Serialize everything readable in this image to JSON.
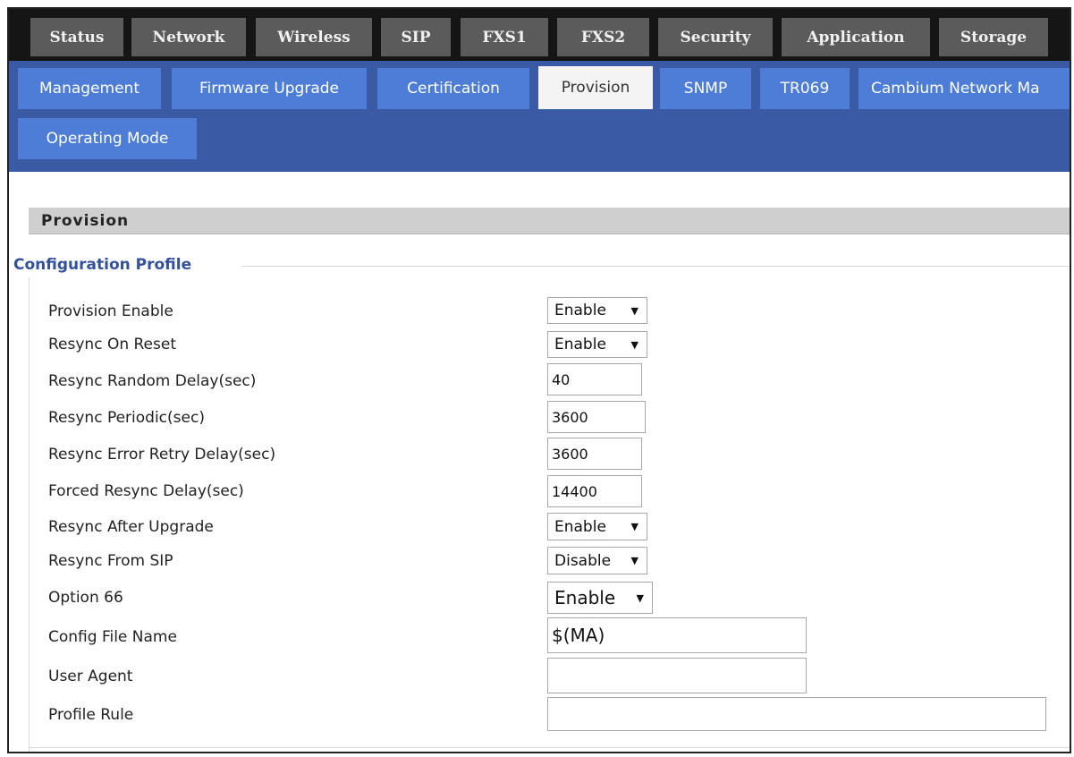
{
  "top_tabs": [
    "Status",
    "Network",
    "Wireless",
    "SIP",
    "FXS1",
    "FXS2",
    "Security",
    "Application",
    "Storage"
  ],
  "sub_tabs": [
    "Management",
    "Firmware Upgrade",
    "Certification",
    "Provision",
    "SNMP",
    "TR069",
    "Cambium Network Ma",
    "Operating Mode"
  ],
  "active_sub_tab": "Provision",
  "section_title": "Provision",
  "fieldset_legend": "Configuration Profile",
  "fields": {
    "provision_enable": {
      "label": "Provision Enable",
      "value": "Enable"
    },
    "resync_on_reset": {
      "label": "Resync On Reset",
      "value": "Enable"
    },
    "resync_random_delay": {
      "label": "Resync Random Delay(sec)",
      "value": "40"
    },
    "resync_periodic": {
      "label": "Resync Periodic(sec)",
      "value": "3600"
    },
    "resync_error_retry_delay": {
      "label": "Resync Error Retry Delay(sec)",
      "value": "3600"
    },
    "forced_resync_delay": {
      "label": "Forced Resync Delay(sec)",
      "value": "14400"
    },
    "resync_after_upgrade": {
      "label": "Resync After Upgrade",
      "value": "Enable"
    },
    "resync_from_sip": {
      "label": "Resync From SIP",
      "value": "Disable"
    },
    "option_66": {
      "label": "Option 66",
      "value": "Enable"
    },
    "config_file_name": {
      "label": "Config File Name",
      "value": "$(MA)"
    },
    "user_agent": {
      "label": "User Agent",
      "value": ""
    },
    "profile_rule": {
      "label": "Profile Rule",
      "value": ""
    }
  },
  "icons": {
    "dropdown_caret": "caret-down-icon"
  },
  "colors": {
    "top_bar_bg": "#151515",
    "top_tab_bg": "#5b5b5b",
    "sub_bar_bg": "#3a5aa6",
    "sub_tab_bg": "#4d7dd6",
    "active_sub_tab_bg": "#f4f4f4",
    "section_header_bg": "#cfcfcf",
    "legend_color": "#34519c"
  }
}
